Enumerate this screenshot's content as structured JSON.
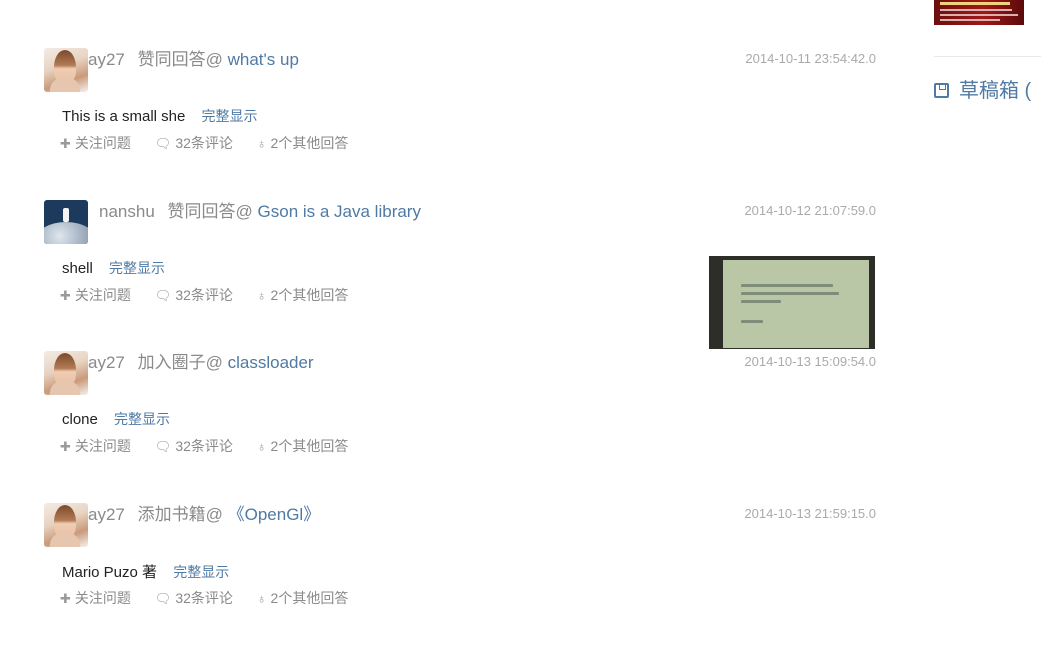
{
  "feed": [
    {
      "user": "ay27",
      "action": "赞同回答@",
      "target": "what's up",
      "time": "2014-10-11 23:54:42.0",
      "body": "This is a small she",
      "more": "完整显示",
      "follow": "关注问题",
      "comments": "32条评论",
      "others": "2个其他回答",
      "avatar": "girl"
    },
    {
      "user": "nanshu",
      "action": "赞同回答@",
      "target": "Gson is a Java library",
      "time": "2014-10-12 21:07:59.0",
      "body": "shell",
      "more": "完整显示",
      "follow": "关注问题",
      "comments": "32条评论",
      "others": "2个其他回答",
      "avatar": "moon"
    },
    {
      "user": "ay27",
      "action": "加入圈子@",
      "target": "classloader",
      "time": "2014-10-13 15:09:54.0",
      "body": "clone",
      "more": "完整显示",
      "follow": "关注问题",
      "comments": "32条评论",
      "others": "2个其他回答",
      "avatar": "girl"
    },
    {
      "user": "ay27",
      "action": "添加书籍@",
      "target": "《OpenGl》",
      "time": "2014-10-13 21:59:15.0",
      "body": "Mario Puzo 著",
      "more": "完整显示",
      "follow": "关注问题",
      "comments": "32条评论",
      "others": "2个其他回答",
      "avatar": "girl"
    }
  ],
  "sidebar": {
    "draft_label": "草稿箱 (",
    "draft_icon": "save-icon"
  },
  "icons": {
    "follow": "plus-icon",
    "comments": "comment-icon",
    "others": "lightbulb-icon"
  },
  "colors": {
    "link": "#4f7aa4",
    "muted": "#8a8a8a",
    "time": "#aaaaaa"
  }
}
